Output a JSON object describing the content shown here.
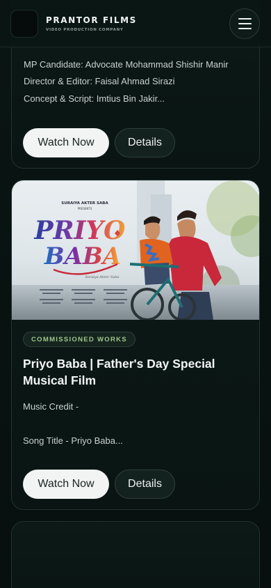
{
  "header": {
    "brand_name": "PRANTOR FILMS",
    "brand_tagline": "VIDEO PRODUCTION COMPANY"
  },
  "card1": {
    "credits": [
      "MP Candidate: Advocate Mohammad Shishir Manir",
      "Director & Editor: Faisal Ahmad Sirazi",
      "Concept & Script: Imtius Bin Jakir..."
    ],
    "watch_label": "Watch Now",
    "details_label": "Details"
  },
  "card2": {
    "thumbnail": {
      "presenter": "SURAIYA AKTER SABA",
      "presents": "PRESENTS",
      "title_line1": "PRIYO",
      "title_line2": "BABA",
      "signature": "Soraiya Akter Saba"
    },
    "badge": "COMMISSIONED WORKS",
    "title": "Priyo Baba | Father's Day Special Musical Film",
    "description_line1": "Music Credit -",
    "description_line2": "Song Title - Priyo Baba...",
    "watch_label": "Watch Now",
    "details_label": "Details"
  },
  "colors": {
    "background": "#07110f",
    "card_border": "#223330",
    "badge_text": "#9fc68a",
    "primary_button": "#f1f4f3"
  }
}
